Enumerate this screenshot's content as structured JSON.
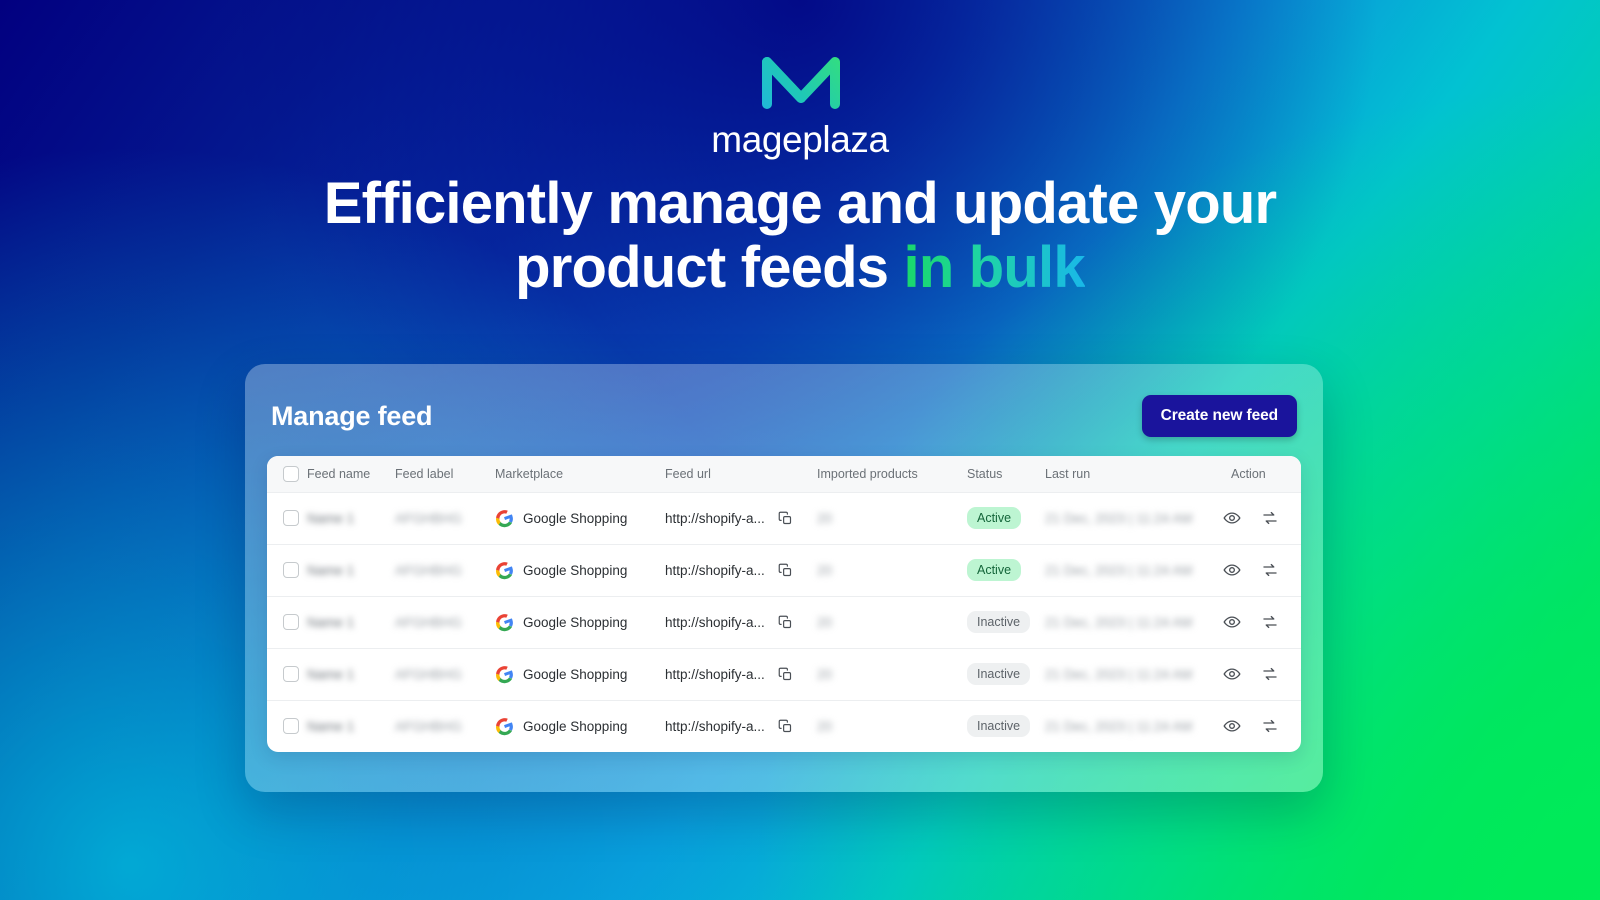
{
  "brand": {
    "logo_icon": "mageplaza-m-monogram-icon",
    "wordmark": "mageplaza"
  },
  "hero": {
    "headline_line1": "Efficiently manage and update your",
    "headline_line2_plain": "product feeds ",
    "headline_line2_accent": "in bulk"
  },
  "colors": {
    "bg_top_left": "#020080",
    "bg_top_right": "#0a32a8",
    "bg_bottom_left": "#00c4d4",
    "bg_bottom_right": "#00e065",
    "accent_gradient_start": "#19d86a",
    "accent_gradient_end": "#19b8e8",
    "button_bg": "#1a149c",
    "status_active_bg": "#bdf5d2",
    "status_active_text": "#14663a",
    "status_inactive_bg": "#eef0f1",
    "status_inactive_text": "#5d6369"
  },
  "card": {
    "title": "Manage feed",
    "create_button": "Create new feed"
  },
  "table": {
    "select_all_checkbox": "",
    "columns": [
      "Feed name",
      "Feed label",
      "Marketplace",
      "Feed url",
      "Imported products",
      "Status",
      "Last run",
      "Action"
    ],
    "action_icons": [
      "eye-icon",
      "sync-icon",
      "trash-icon"
    ],
    "copy_icon": "copy-icon",
    "marketplace_icon": "google-shopping-icon",
    "rows": [
      {
        "feed_name": "Name 1",
        "feed_label": "AFGHBHG",
        "marketplace": "Google Shopping",
        "feed_url": "http://shopify-a...",
        "imported_products": "20",
        "status": "Active",
        "last_run": "21 Dec, 2023 | 11:24 AM"
      },
      {
        "feed_name": "Name 1",
        "feed_label": "AFGHBHG",
        "marketplace": "Google Shopping",
        "feed_url": "http://shopify-a...",
        "imported_products": "20",
        "status": "Active",
        "last_run": "21 Dec, 2023 | 11:24 AM"
      },
      {
        "feed_name": "Name 1",
        "feed_label": "AFGHBHG",
        "marketplace": "Google Shopping",
        "feed_url": "http://shopify-a...",
        "imported_products": "20",
        "status": "Inactive",
        "last_run": "21 Dec, 2023 | 11:24 AM"
      },
      {
        "feed_name": "Name 1",
        "feed_label": "AFGHBHG",
        "marketplace": "Google Shopping",
        "feed_url": "http://shopify-a...",
        "imported_products": "20",
        "status": "Inactive",
        "last_run": "21 Dec, 2023 | 11:24 AM"
      },
      {
        "feed_name": "Name 1",
        "feed_label": "AFGHBHG",
        "marketplace": "Google Shopping",
        "feed_url": "http://shopify-a...",
        "imported_products": "20",
        "status": "Inactive",
        "last_run": "21 Dec, 2023 | 11:24 AM"
      }
    ]
  }
}
